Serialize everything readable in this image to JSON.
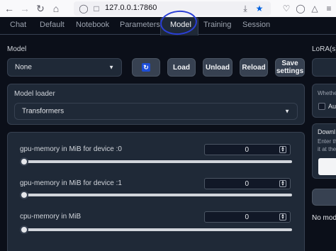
{
  "browser": {
    "url": "127.0.0.1:7860",
    "icons": [
      "back-icon",
      "forward-icon",
      "reload-icon",
      "home-icon",
      "shield-icon",
      "page-icon",
      "downloads-icon",
      "star-icon",
      "pocket-icon",
      "account-icon",
      "extensions-icon",
      "menu-icon"
    ]
  },
  "tabs": [
    {
      "label": "Chat"
    },
    {
      "label": "Default"
    },
    {
      "label": "Notebook"
    },
    {
      "label": "Parameters"
    },
    {
      "label": "Model",
      "active": true
    },
    {
      "label": "Training"
    },
    {
      "label": "Session"
    }
  ],
  "model_section": {
    "label": "Model",
    "selected": "None",
    "buttons": {
      "load": "Load",
      "unload": "Unload",
      "reload": "Reload",
      "save_line1": "Save",
      "save_line2": "settings"
    }
  },
  "loader_section": {
    "label": "Model loader",
    "selected": "Transformers"
  },
  "memory_sliders": [
    {
      "label": "gpu-memory in MiB for device :0",
      "value": "0"
    },
    {
      "label": "gpu-memory in MiB for device :1",
      "value": "0"
    },
    {
      "label": "cpu-memory in MiB",
      "value": "0"
    }
  ],
  "right_column": {
    "lora_label": "LoRA(s)",
    "whether_text": "Whethe",
    "checkbox_label": "Au",
    "download_label": "Downl",
    "enter_text": "Enter th",
    "at_text": "it at the",
    "no_model_text": "No mode"
  },
  "colors": {
    "background": "#0b0f19",
    "panel": "#1f2937",
    "annotation_circle": "#2a3fd6",
    "star": "#0060df"
  }
}
